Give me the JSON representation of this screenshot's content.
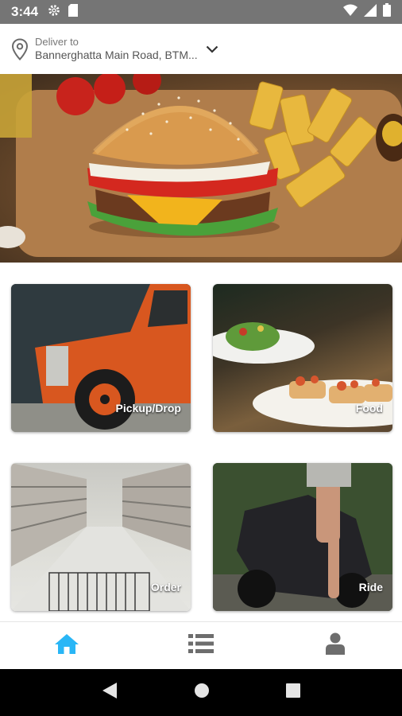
{
  "status_bar": {
    "time": "3:44",
    "icons": [
      "gear-icon",
      "sim-card-icon",
      "wifi-icon",
      "signal-icon",
      "battery-icon"
    ]
  },
  "header": {
    "deliver_label": "Deliver to",
    "address": "Bannerghatta Main Road, BTM...",
    "icons": [
      "location-pin-icon",
      "chevron-down-icon"
    ]
  },
  "services": [
    {
      "label": "Pickup/Drop"
    },
    {
      "label": "Food"
    },
    {
      "label": "Order"
    },
    {
      "label": "Ride"
    }
  ],
  "bottom_nav": {
    "items": [
      "home-icon",
      "list-icon",
      "profile-icon"
    ],
    "active": "home-icon",
    "active_color": "#29b6f6",
    "inactive_color": "#6d6d6d"
  },
  "system_nav": [
    "back-icon",
    "home-circle-icon",
    "recents-icon"
  ]
}
